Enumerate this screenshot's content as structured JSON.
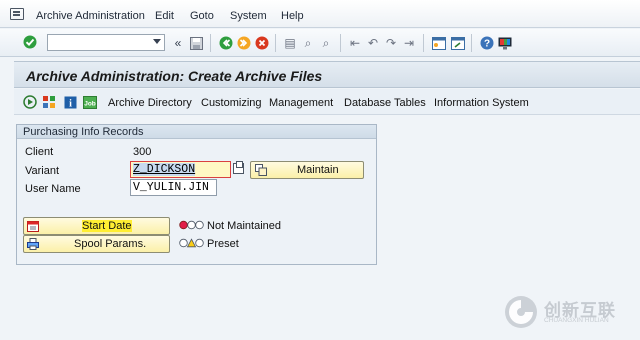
{
  "menu": {
    "items": [
      "Archive Administration",
      "Edit",
      "Goto",
      "System",
      "Help"
    ]
  },
  "toolbar": {
    "command_field_value": "",
    "icons": [
      "enter-icon",
      "save-icon",
      "back-icon",
      "exit-icon",
      "cancel-icon",
      "print-icon",
      "find-icon",
      "find-next-icon",
      "first-page-icon",
      "previous-page-icon",
      "next-page-icon",
      "last-page-icon",
      "create-session-icon",
      "shortcut-icon",
      "help-icon",
      "customize-layout-icon"
    ]
  },
  "page": {
    "title": "Archive Administration: Create Archive Files"
  },
  "app_toolbar": {
    "icons": [
      "execute-icon",
      "variant-icon",
      "info-icon",
      "job-icon"
    ],
    "buttons": [
      "Archive Directory",
      "Customizing",
      "Management",
      "Database Tables",
      "Information System"
    ]
  },
  "group": {
    "title": "Purchasing Info Records",
    "client_label": "Client",
    "client_value": "300",
    "variant_label": "Variant",
    "variant_value": "Z_DICKSON",
    "user_label": "User Name",
    "user_value": "V_YULIN.JIN",
    "maintain_label": "Maintain",
    "start_date_label": "Start Date",
    "spool_label": "Spool Params.",
    "start_status": "Not Maintained",
    "spool_status": "Preset"
  },
  "watermark": {
    "brand": "创新互联",
    "sub": "CHUANGXIN HULIAN"
  }
}
